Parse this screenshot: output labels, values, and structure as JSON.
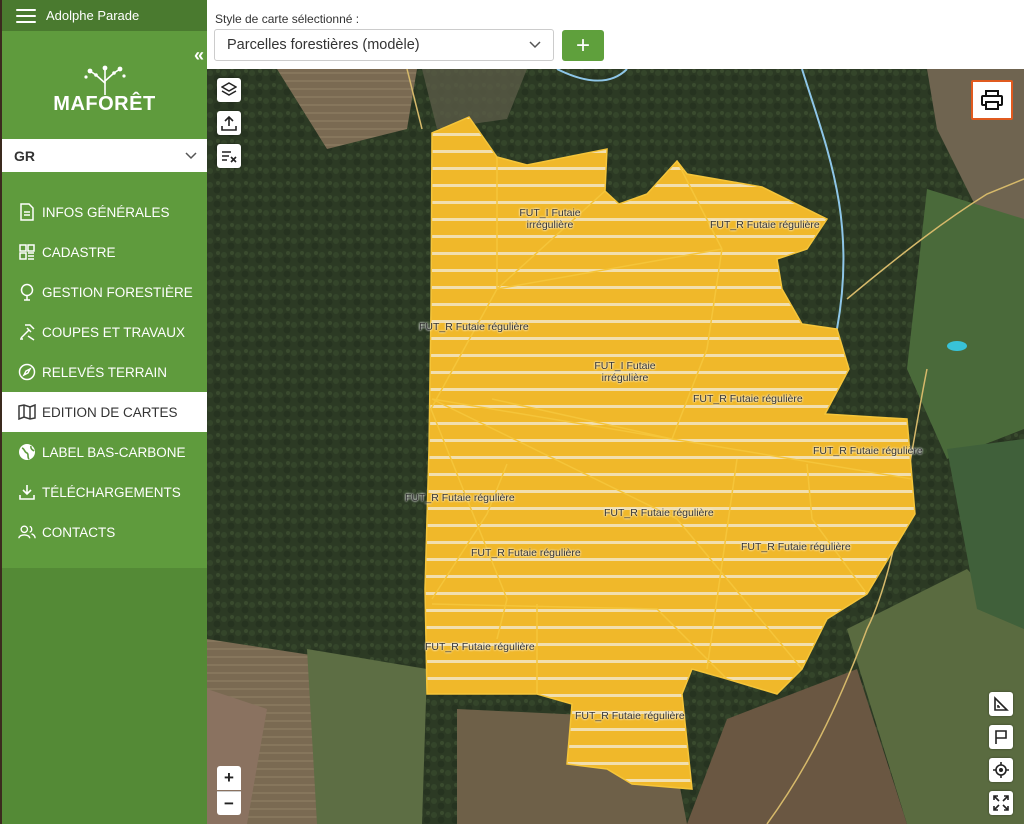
{
  "user": {
    "name": "Adolphe Parade"
  },
  "brand": {
    "logo_text": "MAFORÊT"
  },
  "region": {
    "selected": "GR"
  },
  "nav": {
    "items": [
      {
        "label": "INFOS GÉNÉRALES",
        "icon": "document-icon"
      },
      {
        "label": "CADASTRE",
        "icon": "grid-icon"
      },
      {
        "label": "GESTION FORESTIÈRE",
        "icon": "tree-icon"
      },
      {
        "label": "COUPES ET TRAVAUX",
        "icon": "tools-icon"
      },
      {
        "label": "RELEVÉS TERRAIN",
        "icon": "compass-icon"
      },
      {
        "label": "EDITION DE CARTES",
        "icon": "map-icon",
        "active": true
      },
      {
        "label": "LABEL BAS-CARBONE",
        "icon": "globe-icon"
      },
      {
        "label": "TÉLÉCHARGEMENTS",
        "icon": "download-icon"
      },
      {
        "label": "CONTACTS",
        "icon": "contacts-icon"
      }
    ]
  },
  "toolbar": {
    "style_label": "Style de carte sélectionné :",
    "style_value": "Parcelles forestières (modèle)",
    "add_label": "+"
  },
  "map": {
    "parcel_fill": "#f0b82a",
    "parcel_stroke": "#f5c53a",
    "labels": [
      {
        "text": "FUT_I Futaie irrégulière"
      },
      {
        "text": "FUT_R Futaie régulière"
      },
      {
        "text": "FUT_R Futaie régulière"
      },
      {
        "text": "FUT_I Futaie irrégulière"
      },
      {
        "text": "FUT_R Futaie régulière"
      },
      {
        "text": "FUT_R Futaie régulière"
      },
      {
        "text": "FUT_R Futaie régulière"
      },
      {
        "text": "FUT_R Futaie régulière"
      },
      {
        "text": "FUT_R Futaie régulière"
      },
      {
        "text": "FUT_R Futaie régulière"
      },
      {
        "text": "FUT_R Futaie régulière"
      },
      {
        "text": "FUT_R Futaie régulière"
      }
    ],
    "zoom_in": "+",
    "zoom_out": "−"
  },
  "colors": {
    "sidebar": "#5f9b3d",
    "accent_button": "#5fa03c",
    "print_border": "#e05a1f"
  }
}
